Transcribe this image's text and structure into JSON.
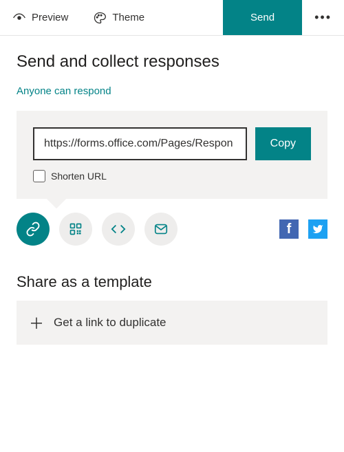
{
  "toolbar": {
    "preview_label": "Preview",
    "theme_label": "Theme",
    "send_label": "Send"
  },
  "send": {
    "heading": "Send and collect responses",
    "respond_label": "Anyone can respond",
    "url_value": "https://forms.office.com/Pages/Respon",
    "copy_label": "Copy",
    "shorten_label": "Shorten URL"
  },
  "template": {
    "heading": "Share as a template",
    "duplicate_label": "Get a link to duplicate"
  },
  "colors": {
    "accent": "#038387"
  }
}
